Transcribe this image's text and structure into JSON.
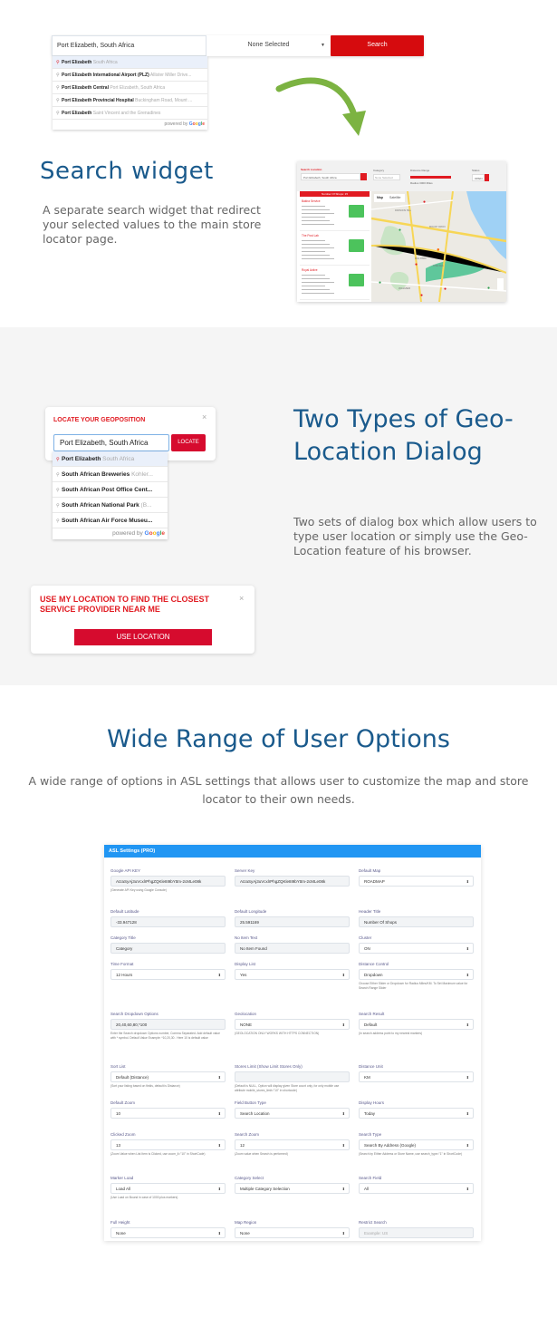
{
  "section_search_widget": {
    "search_bar": {
      "input_value": "Port Elizabeth, South Africa",
      "category_select": "None Selected",
      "search_button": "Search"
    },
    "autocomplete": [
      {
        "main": "Port Elizabeth",
        "sub": "South Africa",
        "active": true
      },
      {
        "main": "Port Elizabeth International Airport (PLZ)",
        "sub": "Allister Miller Drive..."
      },
      {
        "main": "Port Elizabeth Central",
        "sub": "Port Elizabeth, South Africa"
      },
      {
        "main": "Port Elizabeth Provincial Hospital",
        "sub": "Buckingham Road, Mount ..."
      },
      {
        "main": "Port Elizabeth",
        "sub": "Saint Vincent and the Grenadines"
      }
    ],
    "powered_by": "powered by",
    "google": [
      "G",
      "o",
      "o",
      "g",
      "l",
      "e"
    ],
    "title": "Search widget",
    "description": "A separate search widget that redirect your selected values to the main store locator page.",
    "preview": {
      "search_location_label": "Search Location",
      "search_location_value": "Port Elizabeth, South Africa",
      "category_label": "Category",
      "category_value": "None Selected",
      "distance_label": "Distance Range",
      "distance_value": "Radius 3000 Miles",
      "status_label": "Status",
      "status_value": "OPEN",
      "list_header": "Number Of Shops: 15",
      "stores": [
        "Bakira Service",
        "The Post Lab",
        "Royal Active"
      ],
      "map_tabs": [
        "Map",
        "Satellite"
      ],
      "map_labels": [
        "PARSONS HILL",
        "WALMER",
        "MOUNT CROIX",
        "CENTRAL",
        "MILL PARK",
        "CHELSEA",
        "GLENDINNINGVALE"
      ]
    }
  },
  "section_geo": {
    "dialog1": {
      "title": "LOCATE YOUR GEOPOSITION",
      "input_value": "Port Elizabeth, South Africa",
      "button": "LOCATE",
      "autocomplete": [
        {
          "main": "Port Elizabeth",
          "sub": "South Africa",
          "active": true
        },
        {
          "main": "South African Breweries",
          "sub": "Kohler..."
        },
        {
          "main": "South African Post Office Cent...",
          "sub": ""
        },
        {
          "main": "South African National Park",
          "sub": "(B..."
        },
        {
          "main": "South African Air Force Museu...",
          "sub": ""
        }
      ],
      "powered_by": "powered by"
    },
    "dialog2": {
      "title": "USE MY LOCATION TO FIND THE CLOSEST SERVICE PROVIDER NEAR ME",
      "button": "USE LOCATION"
    },
    "title": "Two Types of Geo-Location Dialog",
    "description": "Two sets of dialog box which allow users to type user location or simply use the Geo-Location feature of his browser."
  },
  "section_options": {
    "title": "Wide Range of User Options",
    "description": "A wide range of options in ASL settings that allows user to customize the map and store locator to their own needs.",
    "panel_title": "ASL Settings (PRO)",
    "fields": [
      {
        "label": "Google API KEY",
        "value": "AIzaSyAj3uVcxlrPhgZQKle8I9bYttm-2cMLe08k",
        "type": "text",
        "help": "(Generate API Key using Google Console)"
      },
      {
        "label": "Server Key",
        "value": "AIzaSyAj3uVcxlrPhgZQKle8I9bYttm-2cMLe08k",
        "type": "text",
        "help": ""
      },
      {
        "label": "Default Map",
        "value": "ROADMAP",
        "type": "select",
        "help": ""
      },
      {
        "label": "Default Latitude",
        "value": "-33.947128",
        "type": "text",
        "help": ""
      },
      {
        "label": "Default Longitude",
        "value": "25.591169",
        "type": "text",
        "help": ""
      },
      {
        "label": "Header Title",
        "value": "Number Of Shops",
        "type": "text",
        "help": ""
      },
      {
        "label": "Category Title",
        "value": "Category",
        "type": "text",
        "help": ""
      },
      {
        "label": "No Item Text",
        "value": "No Item Found",
        "type": "text",
        "help": ""
      },
      {
        "label": "Cluster",
        "value": "ON",
        "type": "select",
        "help": ""
      },
      {
        "label": "Time Format",
        "value": "12 Hours",
        "type": "select",
        "help": ""
      },
      {
        "label": "Display List",
        "value": "Yes",
        "type": "select",
        "help": ""
      },
      {
        "label": "Distance Control",
        "value": "Dropdown",
        "type": "select",
        "help": "Choose Either Slider or Dropdown for Radius Miles/KM. To Set Maximum value for Search Range Slider"
      },
      {
        "label": "Search Dropdown Options",
        "value": "20,40,60,80,*100",
        "type": "text",
        "help": "Enter the Search dropdown Options number, Comma Separated. Add default value with * symbol. Default Value Example: *10,20,30 . Here 10 is default value"
      },
      {
        "label": "Geolocation",
        "value": "NONE",
        "type": "select",
        "help": "(GEOLOCATION ONLY WORKS WITH HTTPS CONNECTION)"
      },
      {
        "label": "Search Result",
        "value": "Default",
        "type": "select",
        "help": "(In search address point to my nearest markers)"
      },
      {
        "label": "Sort List",
        "value": "Default (Distance)",
        "type": "select",
        "help": "(Sort your listing based on fields, default is Distance)"
      },
      {
        "label": "Stores Limit (Show Limit Stores Only)",
        "value": "",
        "type": "text",
        "help": "(Default is NULL, Option will display given Store count only, for only mobile use attribute mobile_stores_limit=\"10\" in shortcode)"
      },
      {
        "label": "Distance Unit",
        "value": "KM",
        "type": "select",
        "help": ""
      },
      {
        "label": "Default Zoom",
        "value": "10",
        "type": "select",
        "help": ""
      },
      {
        "label": "Field Button Type",
        "value": "Search Location",
        "type": "select",
        "help": ""
      },
      {
        "label": "Display Hours",
        "value": "Today",
        "type": "select",
        "help": ""
      },
      {
        "label": "Clicked Zoom",
        "value": "13",
        "type": "select",
        "help": "(Zoom Value when List Item is Clicked, use zoom_li=\"10\" in ShortCode)"
      },
      {
        "label": "Search Zoom",
        "value": "12",
        "type": "select",
        "help": "(Zoom value when Search is performed)"
      },
      {
        "label": "Search Type",
        "value": "Search By Address (Google)",
        "type": "select",
        "help": "(Search by Either Address or Store Name, use search_type=\"1\" in ShortCode)"
      },
      {
        "label": "Marker Load",
        "value": "Load All",
        "type": "select",
        "help": "(Use Load on Bound in case of 1000 plus markers)"
      },
      {
        "label": "Category Select",
        "value": "Multiple Category Selection",
        "type": "select",
        "help": ""
      },
      {
        "label": "Search Field",
        "value": "All",
        "type": "select",
        "help": ""
      },
      {
        "label": "Full Height",
        "value": "None",
        "type": "select",
        "help": ""
      },
      {
        "label": "Map Region",
        "value": "None",
        "type": "select",
        "help": ""
      },
      {
        "label": "Restrict Search",
        "value": "",
        "placeholder": "Example: US",
        "type": "text",
        "help": ""
      }
    ]
  },
  "colors": {
    "accent_red": "#d60b0e",
    "heading_blue": "#1a5a8c",
    "panel_blue": "#2196f3",
    "arrow_green": "#7cb342"
  }
}
